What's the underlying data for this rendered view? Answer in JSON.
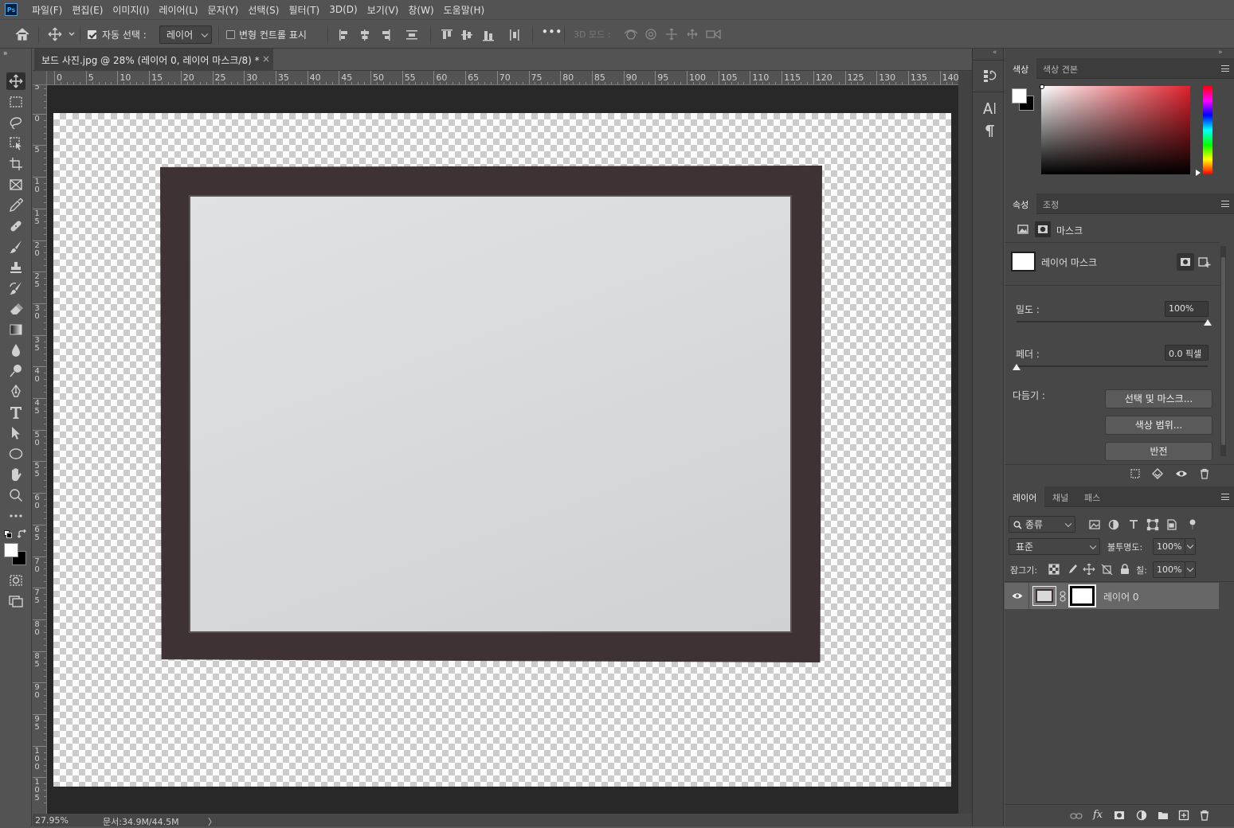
{
  "app": {
    "logo": "Ps"
  },
  "menubar": {
    "items": [
      "파일(F)",
      "편집(E)",
      "이미지(I)",
      "레이어(L)",
      "문자(Y)",
      "선택(S)",
      "필터(T)",
      "3D(D)",
      "보기(V)",
      "창(W)",
      "도움말(H)"
    ]
  },
  "options": {
    "auto_select_label": "자동 선택 :",
    "auto_select_target": "레이어",
    "show_transform_label": "변형 컨트롤 표시",
    "mode_3d_label": "3D 모드 :",
    "more": "•••"
  },
  "document": {
    "tab_title": "보드 사진.jpg @ 28% (레이어 0, 레이어 마스크/8) *",
    "close_glyph": "×",
    "ruler_h": [
      "0",
      "5",
      "10",
      "15",
      "20",
      "25",
      "30",
      "35",
      "40",
      "45",
      "50",
      "55",
      "60",
      "65",
      "70",
      "75",
      "80",
      "85",
      "90",
      "95",
      "100",
      "105",
      "110",
      "115",
      "120",
      "125",
      "130",
      "135",
      "140"
    ],
    "ruler_v": [
      "5",
      "0",
      "5",
      "10",
      "15",
      "20",
      "25",
      "30",
      "35",
      "40",
      "45",
      "50",
      "55",
      "60",
      "65",
      "70",
      "75",
      "80",
      "85",
      "90",
      "95",
      "100",
      "105"
    ],
    "zoom": "27.95%",
    "doc_size": "문서:34.9M/44.5M",
    "status_arrow": "〉"
  },
  "color_panel": {
    "tabs": [
      "색상",
      "색상 견본"
    ],
    "foreground": "#ffffff",
    "background": "#000000"
  },
  "properties_panel": {
    "tabs": [
      "속성",
      "조정"
    ],
    "mask_header": "마스크",
    "layer_mask_label": "레이어 마스크",
    "density_label": "밀도 :",
    "density_value": "100%",
    "feather_label": "페더 :",
    "feather_value": "0.0 픽셀",
    "refine_label": "다듬기 :",
    "select_mask_button": "선택 및 마스크...",
    "color_range_button": "색상 범위...",
    "invert_button": "반전",
    "density_level": 1.0,
    "feather_level": 0.0
  },
  "layers_panel": {
    "tabs": [
      "레이어",
      "채널",
      "패스"
    ],
    "filter_kind": "종류",
    "blend_mode": "표준",
    "opacity_label": "불투명도:",
    "opacity_value": "100%",
    "lock_label": "잠그기:",
    "fill_label": "칠:",
    "fill_value": "100%",
    "layers": [
      {
        "name": "레이어 0",
        "visible": true
      }
    ],
    "footer_fx": "fx"
  }
}
